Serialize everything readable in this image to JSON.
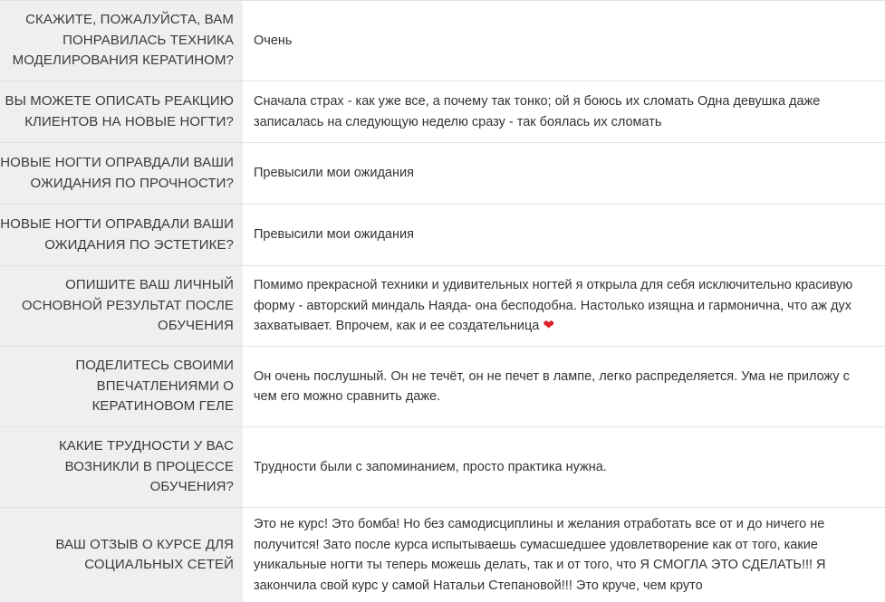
{
  "rows": [
    {
      "question": "Скажите, пожалуйста, вам понравилась техника моделирования кератином?",
      "answer": "Очень"
    },
    {
      "question": "Вы можете описать реакцию клиентов на новые ногти?",
      "answer": "Сначала страх - как уже все, а почему так тонко; ой я боюсь их сломать Одна девушка даже записалась на следующую неделю сразу - так боялась их сломать"
    },
    {
      "question": "Новые ногти оправдали ваши ожидания по прочности?",
      "answer": "Превысили мои ожидания"
    },
    {
      "question": "Новые ногти оправдали ваши ожидания по эстетике?",
      "answer": "Превысили мои ожидания"
    },
    {
      "question": "Опишите ваш личный основной результат после обучения",
      "answer": "Помимо прекрасной техники и удивительных ногтей я открыла для себя исключительно красивую форму - авторский миндаль Наяда- она бесподобна. Настолько изящна и гармонична, что аж дух захватывает. Впрочем, как и ее создательница",
      "answer_icon": "heart-icon"
    },
    {
      "question": "Поделитесь своими впечатлениями о кератиновом геле",
      "answer": "Он очень послушный. Он не течёт, он не печет в лампе, легко распределяется. Ума не приложу с чем его можно сравнить даже."
    },
    {
      "question": "Какие трудности у вас возникли в процессе обучения?",
      "answer": "Трудности были с запоминанием, просто практика нужна."
    },
    {
      "question": "Ваш отзыв о курсе для социальных сетей",
      "answer": "Это не курс! Это бомба! Но без самодисциплины и желания отработать все от и до ничего не получится! Зато после курса испытываешь сумасшедшее удовлетворение как от того, какие уникальные ногти ты теперь можешь делать, так и от того, что Я СМОГЛА ЭТО СДЕЛАТЬ!!! Я закончила свой курс у самой Натальи Степановой!!! Это круче, чем круто"
    }
  ],
  "colors": {
    "question_bg": "#efefef",
    "border": "#e2e2e2",
    "heart": "#e0202a"
  }
}
